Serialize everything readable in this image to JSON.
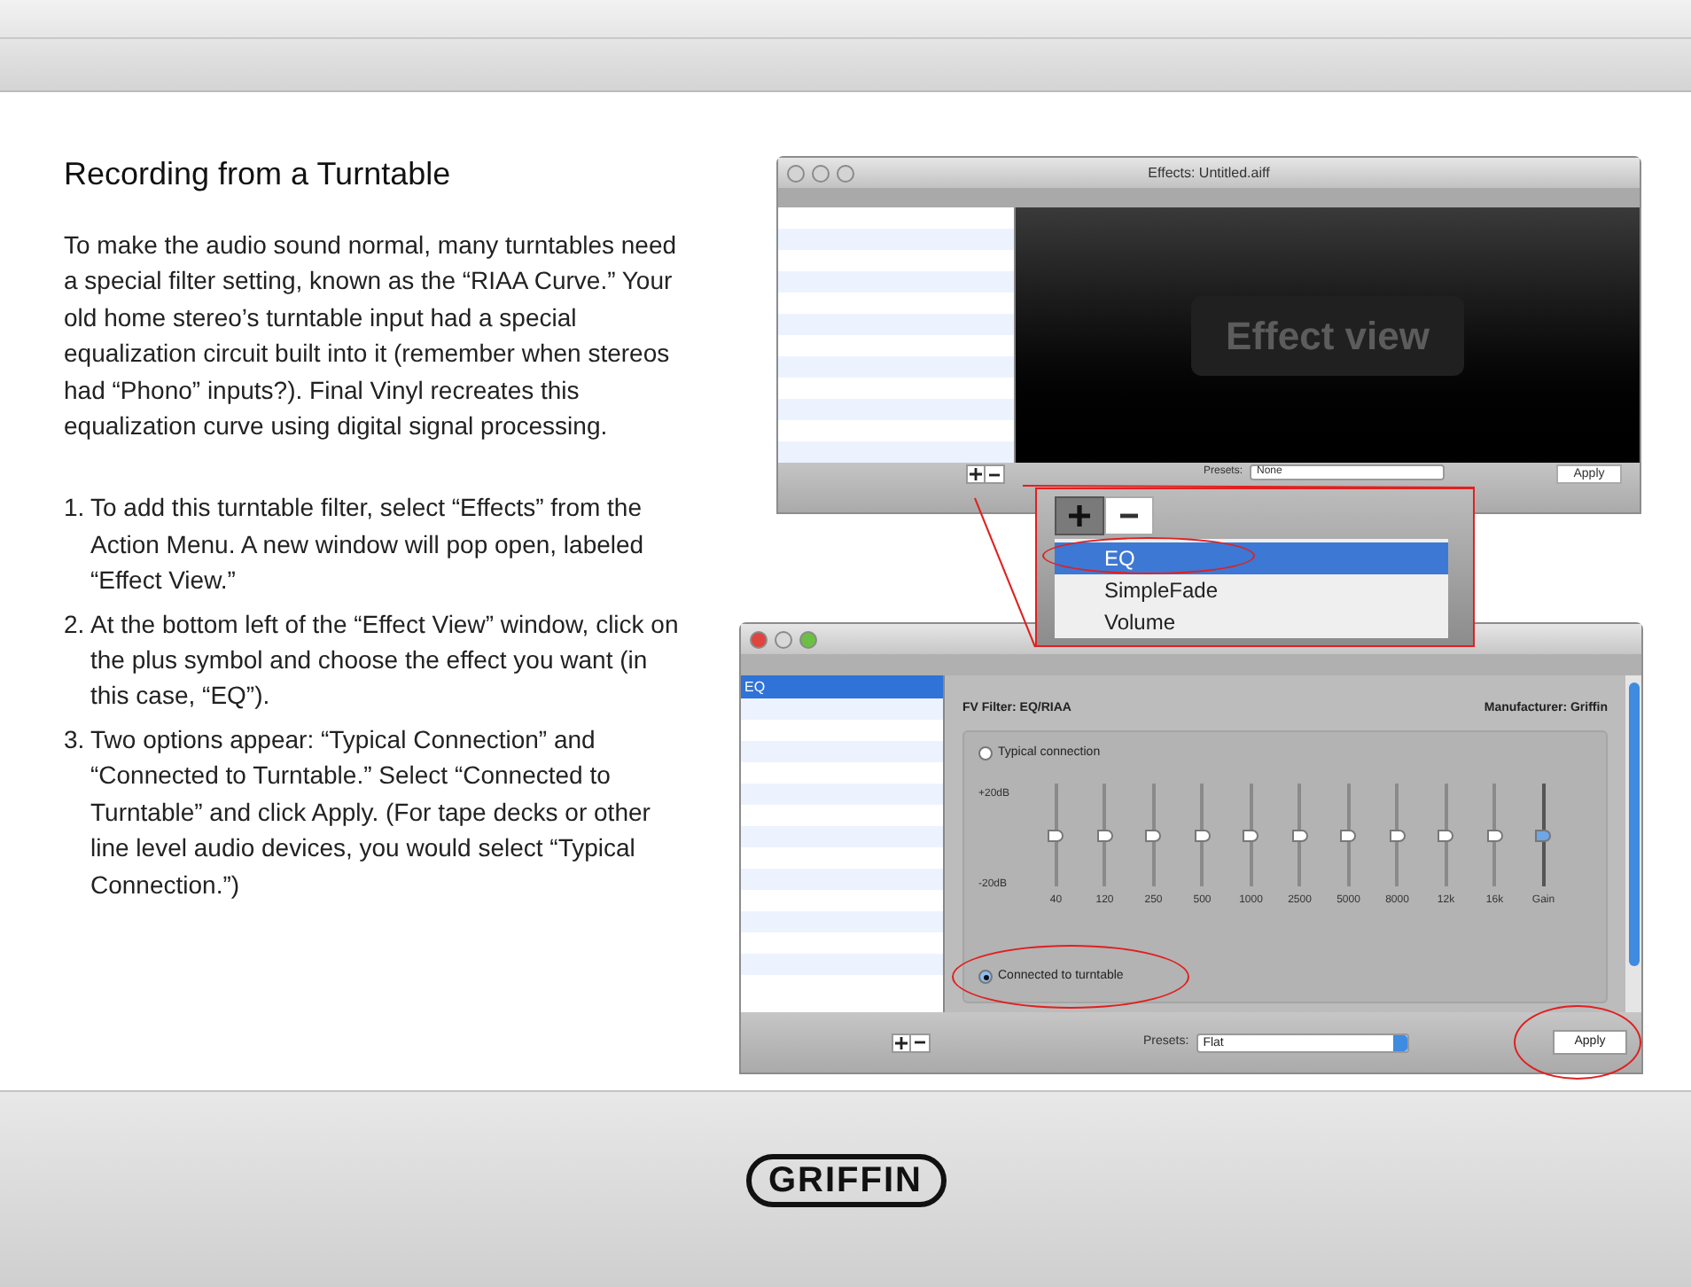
{
  "heading": "Recording from a Turntable",
  "intro": "To make the audio sound normal, many turntables need a special filter setting, known as the “RIAA Curve.” Your old home stereo’s turntable input had a special equalization circuit built into it (remember when stereos had “Phono” inputs?). Final Vinyl recreates this equalization curve using digital signal processing.",
  "steps": [
    {
      "number": "1.",
      "text": "To add this turntable filter, select “Effects” from the Action Menu. A new window will pop open, labeled “Effect View.”"
    },
    {
      "number": "2.",
      "text": "At the bottom left of the “Effect View” window, click on the plus symbol and choose the effect you want (in this case, “EQ”)."
    },
    {
      "number": "3.",
      "text": "Two options appear: “Typical Connection” and “Connected to Turntable.” Select “Connected to Turntable” and click Apply. (For tape decks or other line level audio devices, you would select “Typical Connection.”)"
    }
  ],
  "effects_window": {
    "title": "Effects: Untitled.aiff",
    "effect_view_label": "Effect view",
    "presets_label": "Presets:",
    "presets_value": "None",
    "apply_button": "Apply"
  },
  "menu_popup": {
    "items": [
      {
        "label": "EQ",
        "selected": true
      },
      {
        "label": "SimpleFade",
        "selected": false
      },
      {
        "label": "Volume",
        "selected": false
      }
    ]
  },
  "eq_window": {
    "effects_list": [
      {
        "label": "EQ",
        "selected": true
      }
    ],
    "filter_label": "FV Filter: EQ/RIAA",
    "manufacturer": "Manufacturer: Griffin",
    "connections": [
      {
        "label": "Typical connection",
        "selected": false
      },
      {
        "label": "Connected to turntable",
        "selected": true
      }
    ],
    "db_max": "+20dB",
    "db_min": "-20dB",
    "bands": [
      {
        "label": "40",
        "level": 0.5,
        "kind": "band"
      },
      {
        "label": "120",
        "level": 0.5,
        "kind": "band"
      },
      {
        "label": "250",
        "level": 0.5,
        "kind": "band"
      },
      {
        "label": "500",
        "level": 0.5,
        "kind": "band"
      },
      {
        "label": "1000",
        "level": 0.5,
        "kind": "band"
      },
      {
        "label": "2500",
        "level": 0.5,
        "kind": "band"
      },
      {
        "label": "5000",
        "level": 0.5,
        "kind": "band"
      },
      {
        "label": "8000",
        "level": 0.5,
        "kind": "band"
      },
      {
        "label": "12k",
        "level": 0.5,
        "kind": "band"
      },
      {
        "label": "16k",
        "level": 0.5,
        "kind": "band"
      },
      {
        "label": "Gain",
        "level": 0.5,
        "kind": "gain"
      }
    ],
    "presets_label": "Presets:",
    "presets_value": "Flat",
    "apply_button": "Apply"
  },
  "footer": {
    "logo": "GRIFFIN"
  }
}
